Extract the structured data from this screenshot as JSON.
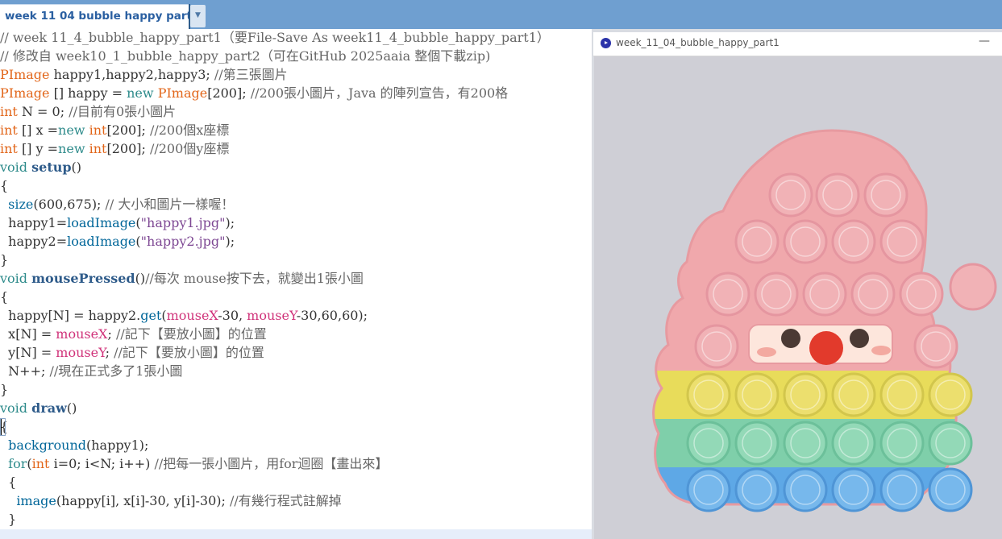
{
  "editor_tab": {
    "label": "week 11 04 bubble happy part1",
    "menu_arrow": "▼"
  },
  "sketch_window": {
    "title": "week_11_04_bubble_happy_part1",
    "minimize": "—",
    "icon": "processing-logo-icon"
  },
  "code": [
    [
      {
        "c": "c",
        "t": "// week 11_4_bubble_happy_part1（要File-Save As week11_4_bubble_happy_part1）"
      }
    ],
    [
      {
        "c": "c",
        "t": "// 修改自 week10_1_bubble_happy_part2（可在GitHub 2025aaia 整個下載zip)"
      }
    ],
    [
      {
        "c": "t",
        "t": "PImage"
      },
      {
        "c": "",
        "t": " happy1,happy2,happy3; "
      },
      {
        "c": "c",
        "t": "//第三張圖片"
      }
    ],
    [
      {
        "c": "t",
        "t": "PImage"
      },
      {
        "c": "",
        "t": " [] happy = "
      },
      {
        "c": "k",
        "t": "new"
      },
      {
        "c": "",
        "t": " "
      },
      {
        "c": "t",
        "t": "PImage"
      },
      {
        "c": "",
        "t": "[200]; "
      },
      {
        "c": "c",
        "t": "//200張小圖片，Java 的陣列宣告，有200格"
      }
    ],
    [
      {
        "c": "t",
        "t": "int"
      },
      {
        "c": "",
        "t": " N = 0; "
      },
      {
        "c": "c",
        "t": "//目前有0張小圖片"
      }
    ],
    [
      {
        "c": "t",
        "t": "int"
      },
      {
        "c": "",
        "t": " [] x ="
      },
      {
        "c": "k",
        "t": "new"
      },
      {
        "c": "",
        "t": " "
      },
      {
        "c": "t",
        "t": "int"
      },
      {
        "c": "",
        "t": "[200]; "
      },
      {
        "c": "c",
        "t": "//200個x座標"
      }
    ],
    [
      {
        "c": "t",
        "t": "int"
      },
      {
        "c": "",
        "t": " [] y ="
      },
      {
        "c": "k",
        "t": "new"
      },
      {
        "c": "",
        "t": " "
      },
      {
        "c": "t",
        "t": "int"
      },
      {
        "c": "",
        "t": "[200]; "
      },
      {
        "c": "c",
        "t": "//200個y座標"
      }
    ],
    [
      {
        "c": "k",
        "t": "void"
      },
      {
        "c": "",
        "t": " "
      },
      {
        "c": "d",
        "t": "setup"
      },
      {
        "c": "",
        "t": "()"
      }
    ],
    [
      {
        "c": "",
        "t": "{"
      }
    ],
    [
      {
        "c": "",
        "t": "  "
      },
      {
        "c": "f",
        "t": "size"
      },
      {
        "c": "",
        "t": "(600,675); "
      },
      {
        "c": "c",
        "t": "// 大小和圖片一樣喔！"
      }
    ],
    [
      {
        "c": "",
        "t": "  happy1="
      },
      {
        "c": "f",
        "t": "loadImage"
      },
      {
        "c": "",
        "t": "("
      },
      {
        "c": "s",
        "t": "\"happy1.jpg\""
      },
      {
        "c": "",
        "t": ");"
      }
    ],
    [
      {
        "c": "",
        "t": "  happy2="
      },
      {
        "c": "f",
        "t": "loadImage"
      },
      {
        "c": "",
        "t": "("
      },
      {
        "c": "s",
        "t": "\"happy2.jpg\""
      },
      {
        "c": "",
        "t": ");"
      }
    ],
    [
      {
        "c": "",
        "t": "}"
      }
    ],
    [
      {
        "c": "k",
        "t": "void"
      },
      {
        "c": "",
        "t": " "
      },
      {
        "c": "d",
        "t": "mousePressed"
      },
      {
        "c": "",
        "t": "()"
      },
      {
        "c": "c",
        "t": "//每次 mouse按下去，就變出1張小圖"
      }
    ],
    [
      {
        "c": "",
        "t": "{"
      }
    ],
    [
      {
        "c": "",
        "t": "  happy[N] = happy2."
      },
      {
        "c": "f",
        "t": "get"
      },
      {
        "c": "",
        "t": "("
      },
      {
        "c": "v",
        "t": "mouseX"
      },
      {
        "c": "",
        "t": "-30, "
      },
      {
        "c": "v",
        "t": "mouseY"
      },
      {
        "c": "",
        "t": "-30,60,60);"
      }
    ],
    [
      {
        "c": "",
        "t": "  x[N] = "
      },
      {
        "c": "v",
        "t": "mouseX"
      },
      {
        "c": "",
        "t": "; "
      },
      {
        "c": "c",
        "t": "//記下【要放小圖】的位置"
      }
    ],
    [
      {
        "c": "",
        "t": "  y[N] = "
      },
      {
        "c": "v",
        "t": "mouseY"
      },
      {
        "c": "",
        "t": "; "
      },
      {
        "c": "c",
        "t": "//記下【要放小圖】的位置"
      }
    ],
    [
      {
        "c": "",
        "t": "  N++; "
      },
      {
        "c": "c",
        "t": "//現在正式多了1張小圖"
      }
    ],
    [
      {
        "c": "",
        "t": "}"
      }
    ],
    [
      {
        "c": "k",
        "t": "void"
      },
      {
        "c": "",
        "t": " "
      },
      {
        "c": "d",
        "t": "draw"
      },
      {
        "c": "",
        "t": "()"
      }
    ],
    [
      {
        "c": "",
        "t": "{"
      }
    ],
    [
      {
        "c": "",
        "t": "  "
      },
      {
        "c": "f",
        "t": "background"
      },
      {
        "c": "",
        "t": "(happy1);"
      }
    ],
    [
      {
        "c": "",
        "t": "  "
      },
      {
        "c": "k",
        "t": "for"
      },
      {
        "c": "",
        "t": "("
      },
      {
        "c": "t",
        "t": "int"
      },
      {
        "c": "",
        "t": " i=0; i<N; i++) "
      },
      {
        "c": "c",
        "t": "//把每一張小圖片，用for迴圈【畫出來】"
      }
    ],
    [
      {
        "c": "",
        "t": "  {"
      }
    ],
    [
      {
        "c": "",
        "t": "    "
      },
      {
        "c": "f",
        "t": "image"
      },
      {
        "c": "",
        "t": "(happy[i], x[i]-30, y[i]-30); "
      },
      {
        "c": "c",
        "t": "//有幾行程式註解掉"
      }
    ],
    [
      {
        "c": "",
        "t": "  }"
      }
    ]
  ],
  "colors": {
    "tabbar": "#6f9fd0",
    "type": "#e2661a",
    "keyword": "#2e8b8b",
    "function": "#006699",
    "string": "#7d4793",
    "variable": "#d0337a",
    "comment": "#666666"
  }
}
